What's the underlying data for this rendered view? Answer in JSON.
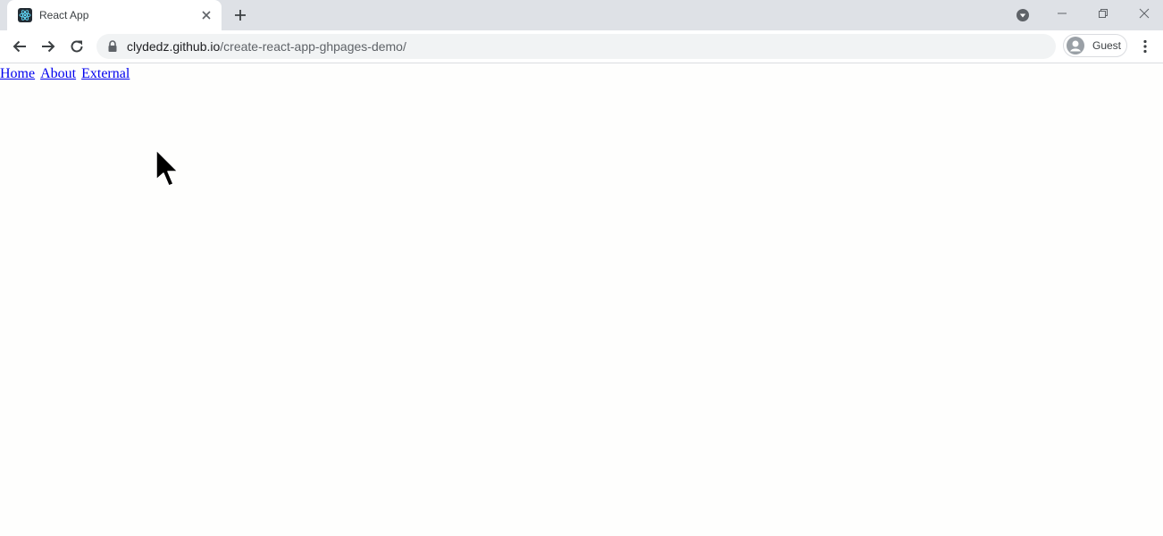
{
  "browser": {
    "tab": {
      "title": "React App",
      "favicon": "react-logo-icon"
    },
    "url": {
      "host": "clydedz.github.io",
      "path": "/create-react-app-ghpages-demo/"
    },
    "profile": {
      "label": "Guest"
    },
    "colors": {
      "tabstrip": "#dee1e6",
      "omnibox": "#f1f3f4",
      "link": "#0000ee",
      "react": "#61dafb"
    }
  },
  "page": {
    "nav": {
      "home": "Home",
      "about": "About",
      "external": "External"
    }
  }
}
